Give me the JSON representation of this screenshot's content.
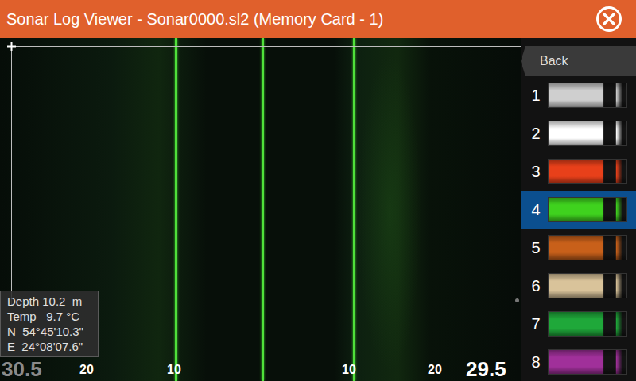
{
  "window": {
    "title": "Sonar Log Viewer - Sonar0000.sl2 (Memory Card - 1)"
  },
  "sidebar": {
    "back": "Back",
    "palettes": [
      {
        "label": "1",
        "selected": false,
        "color": "#cfcfcf"
      },
      {
        "label": "2",
        "selected": false,
        "color": "#ffffff"
      },
      {
        "label": "3",
        "selected": false,
        "color": "#e8401a"
      },
      {
        "label": "4",
        "selected": true,
        "color": "#3fd21e"
      },
      {
        "label": "5",
        "selected": false,
        "color": "#c8601a"
      },
      {
        "label": "6",
        "selected": false,
        "color": "#d9c39a"
      },
      {
        "label": "7",
        "selected": false,
        "color": "#1fa83a"
      },
      {
        "label": "8",
        "selected": false,
        "color": "#a0309a"
      }
    ]
  },
  "readout": [
    "Depth 10.2  m",
    "Temp   9.7 °C",
    "N  54°45'10.3\"",
    "E  24°08'07.6\""
  ],
  "range_scale": [
    "30.5",
    "20",
    "10",
    "10",
    "20",
    "29.5"
  ]
}
